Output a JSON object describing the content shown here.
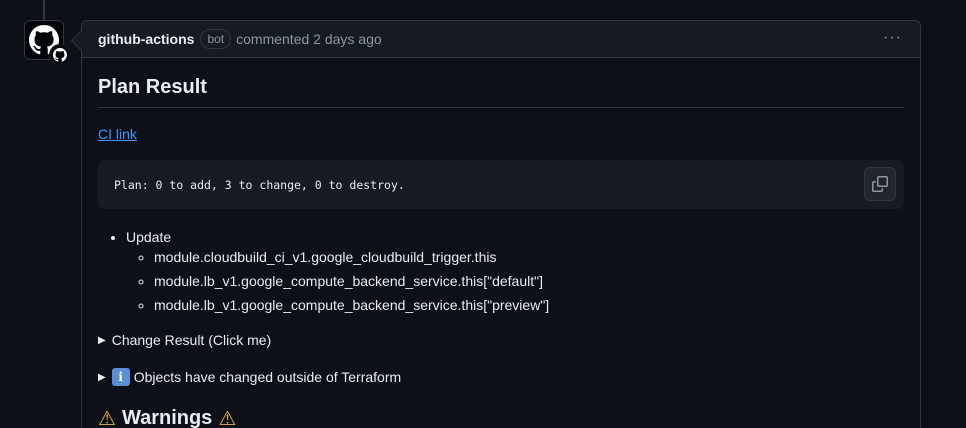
{
  "comment": {
    "author": "github-actions",
    "bot_label": "bot",
    "commented": "commented 2 days ago",
    "menu_label": "···"
  },
  "body": {
    "title": "Plan Result",
    "ci_link": "CI link",
    "code": "Plan: 0 to add, 3 to change, 0 to destroy.",
    "list": {
      "label": "Update",
      "items": [
        "module.cloudbuild_ci_v1.google_cloudbuild_trigger.this",
        "module.lb_v1.google_compute_backend_service.this[\"default\"]",
        "module.lb_v1.google_compute_backend_service.this[\"preview\"]"
      ]
    },
    "details": [
      {
        "summary": "Change Result (Click me)"
      },
      {
        "summary": "Objects have changed outside of Terraform",
        "icon": "i"
      }
    ],
    "warnings_heading": "Warnings"
  },
  "colors": {
    "background": "#0d1117",
    "header_bg": "#161b22",
    "border": "#30363d",
    "link": "#4493f8",
    "muted": "#8d96a0",
    "warning": "#e3b341"
  },
  "icons": {
    "avatar": "github-mark-icon",
    "badge": "github-app-badge-icon",
    "copy": "copy-icon",
    "info": "info-icon",
    "warning": "warning-icon"
  }
}
